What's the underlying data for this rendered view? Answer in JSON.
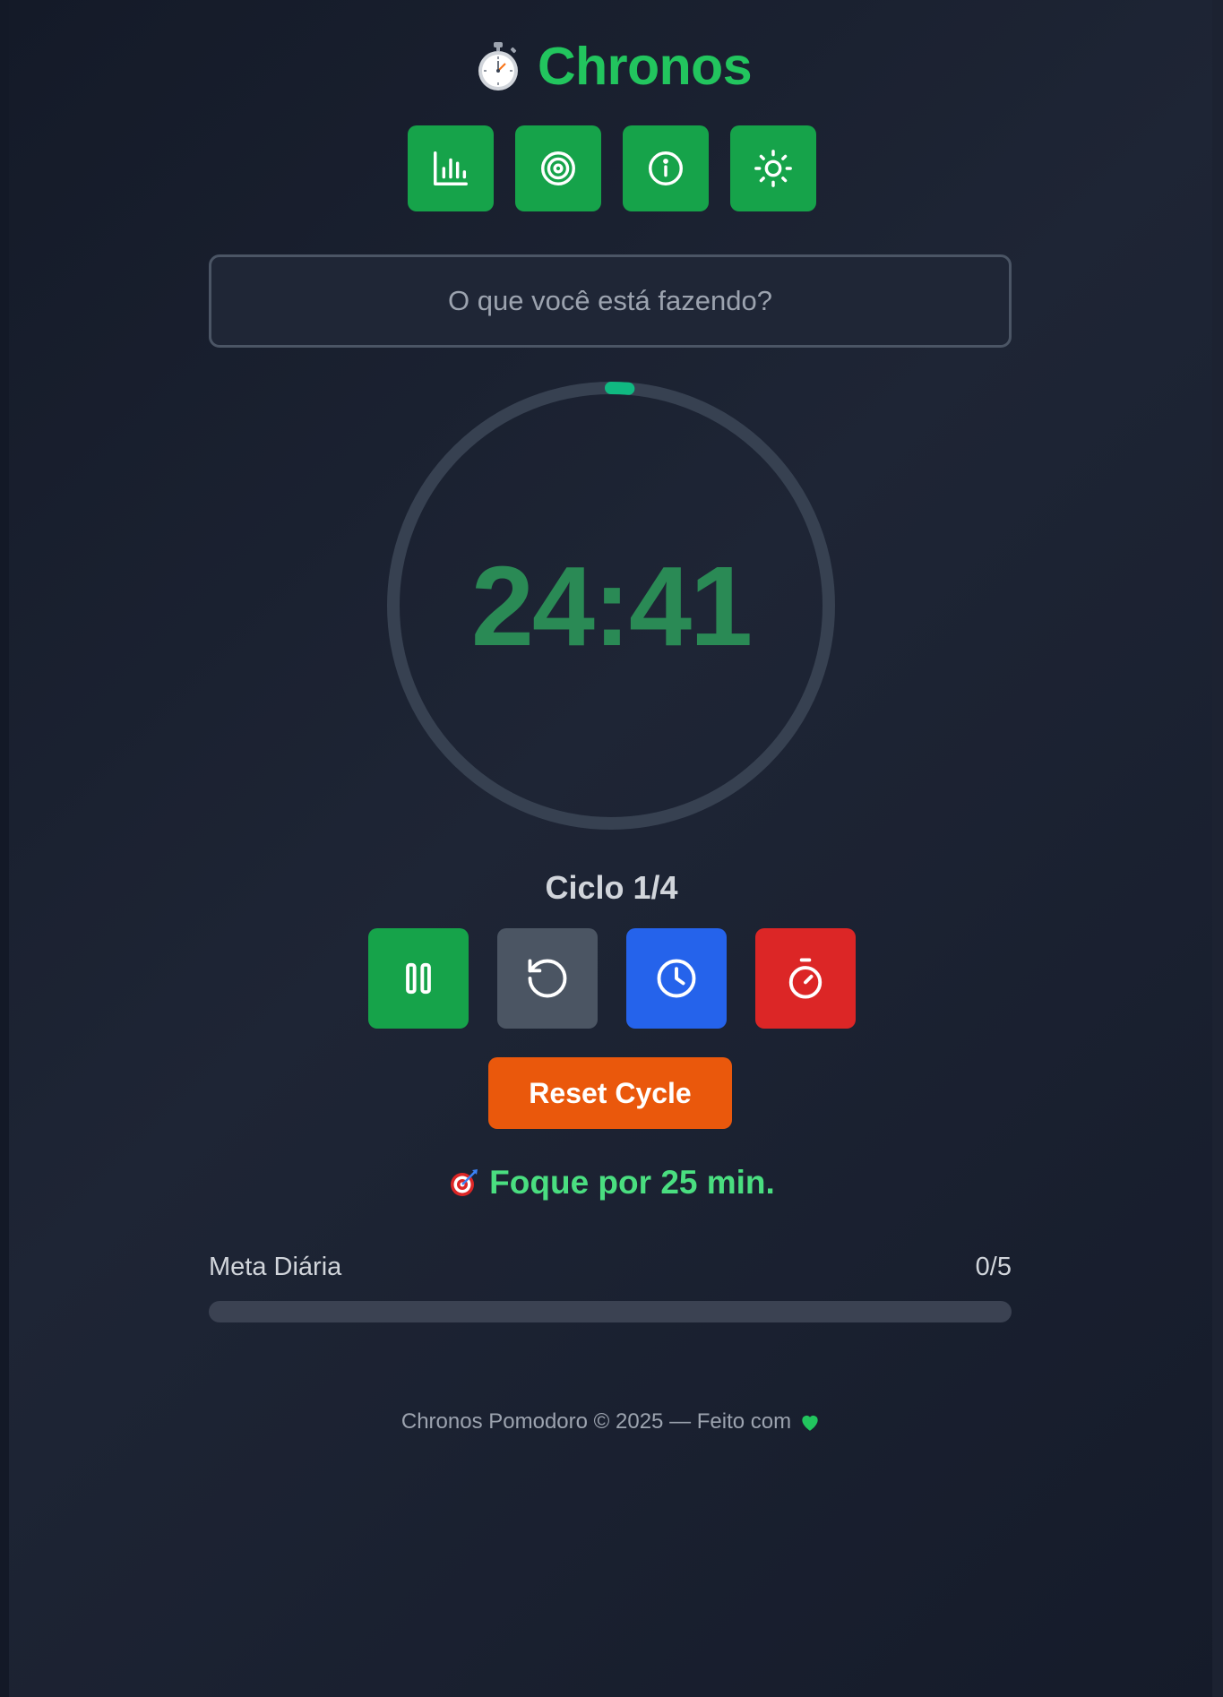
{
  "header": {
    "title": "Chronos",
    "logo_icon": "stopwatch-icon"
  },
  "toolbar": {
    "buttons": [
      {
        "name": "stats",
        "icon": "bar-chart-icon"
      },
      {
        "name": "goals",
        "icon": "target-icon"
      },
      {
        "name": "info",
        "icon": "info-icon"
      },
      {
        "name": "theme",
        "icon": "sun-icon"
      }
    ],
    "color": "#16a34a"
  },
  "task": {
    "placeholder": "O que você está fazendo?",
    "value": ""
  },
  "timer": {
    "display": "24:41",
    "progress": 0.0127,
    "ring_color": "#10b981",
    "track_color": "#374151"
  },
  "cycle": {
    "label": "Ciclo 1/4"
  },
  "controls": [
    {
      "name": "pause",
      "icon": "pause-icon",
      "color": "#16a34a"
    },
    {
      "name": "restart",
      "icon": "rotate-ccw-icon",
      "color": "#4b5563"
    },
    {
      "name": "clock",
      "icon": "clock-icon",
      "color": "#2563eb"
    },
    {
      "name": "timer",
      "icon": "timer-icon",
      "color": "#dc2626"
    }
  ],
  "reset_cycle": {
    "label": "Reset Cycle",
    "color": "#ea580c"
  },
  "focus_message": {
    "icon": "dart-target-icon",
    "text": "Foque por 25 min."
  },
  "daily_goal": {
    "label": "Meta Diária",
    "count": "0/5",
    "progress": 0
  },
  "footer": {
    "text": "Chronos Pomodoro © 2025 — Feito com",
    "icon": "green-heart-icon"
  }
}
